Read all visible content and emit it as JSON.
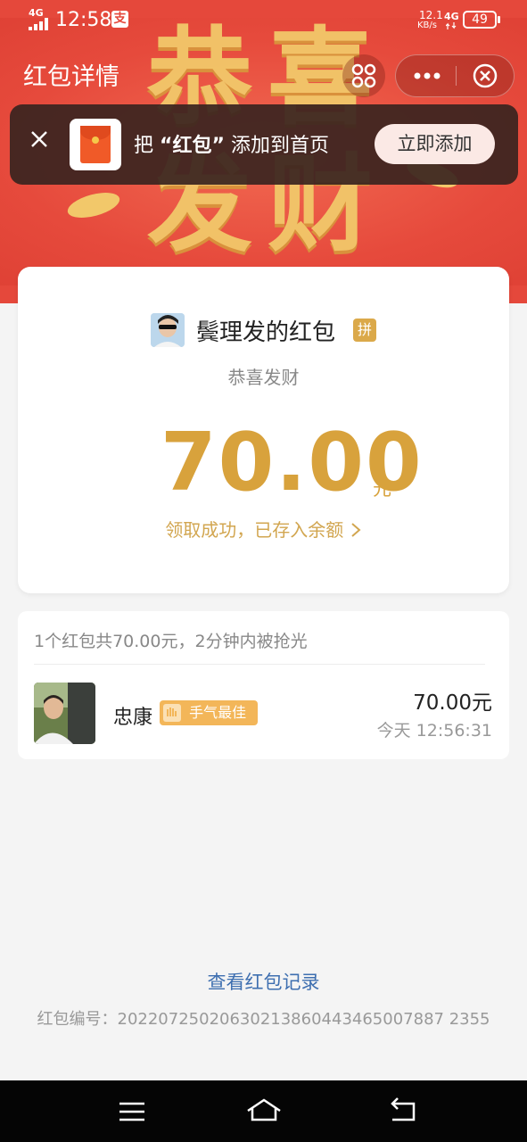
{
  "status_bar": {
    "network": "4G",
    "time": "12:58",
    "alipay_badge": "支",
    "speed_value": "12.1",
    "speed_unit": "KB/s",
    "network_right": "4G",
    "battery": "49"
  },
  "header": {
    "title": "红包详情",
    "decoration_chars": [
      "恭",
      "喜",
      "发",
      "财"
    ],
    "colors": {
      "red": "#e5483b",
      "gold": "#f2c86a"
    }
  },
  "banner": {
    "text_prefix": "把",
    "text_highlight": "“红包”",
    "text_suffix": "添加到首页",
    "add_button": "立即添加"
  },
  "packet": {
    "sender_name": "鬓理发的红包",
    "pin_badge": "拼",
    "wish": "恭喜发财",
    "amount": "70.00",
    "unit": "元",
    "received_text": "领取成功，已存入余额",
    "amount_color": "#d8a23c"
  },
  "records": {
    "summary": "1个红包共70.00元，2分钟内被抢光",
    "items": [
      {
        "name": "忠康",
        "badge": "手气最佳",
        "amount": "70.00元",
        "time": "今天 12:56:31"
      }
    ]
  },
  "footer": {
    "records_link": "查看红包记录",
    "packet_id_label": "红包编号：",
    "packet_id": "20220725020630213860443465007887 2355"
  }
}
